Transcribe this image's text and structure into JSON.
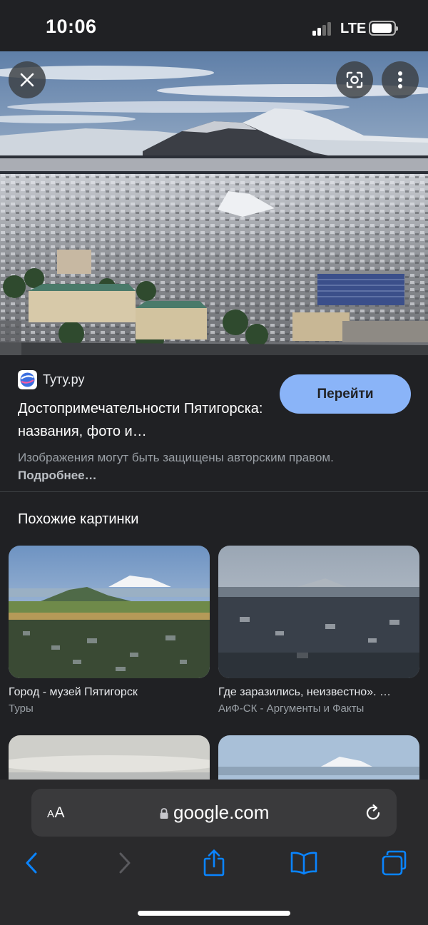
{
  "status_bar": {
    "time": "10:06",
    "network": "LTE"
  },
  "viewer": {
    "close_icon": "close-icon",
    "lens_icon": "google-lens-icon",
    "more_icon": "more-vertical-icon"
  },
  "result": {
    "site_name": "Туту.ру",
    "title": "Достопримечательности Пятигорска: названия, фото и…",
    "go_button": "Перейти",
    "copyright_text": "Изображения могут быть защищены авторским правом.",
    "more_link": "Подробнее…"
  },
  "similar": {
    "heading": "Похожие картинки",
    "items": [
      {
        "title": "Город - музей Пятигорск",
        "source": "Туры"
      },
      {
        "title": "Где заразились, неизвестно». …",
        "source": "АиФ-СК - Аргументы и Факты"
      }
    ]
  },
  "browser": {
    "aa_label_small": "A",
    "aa_label_large": "A",
    "url": "google.com"
  },
  "colors": {
    "background": "#202124",
    "accent_button": "#8ab4f8",
    "toolbar_blue": "#0a84ff"
  }
}
